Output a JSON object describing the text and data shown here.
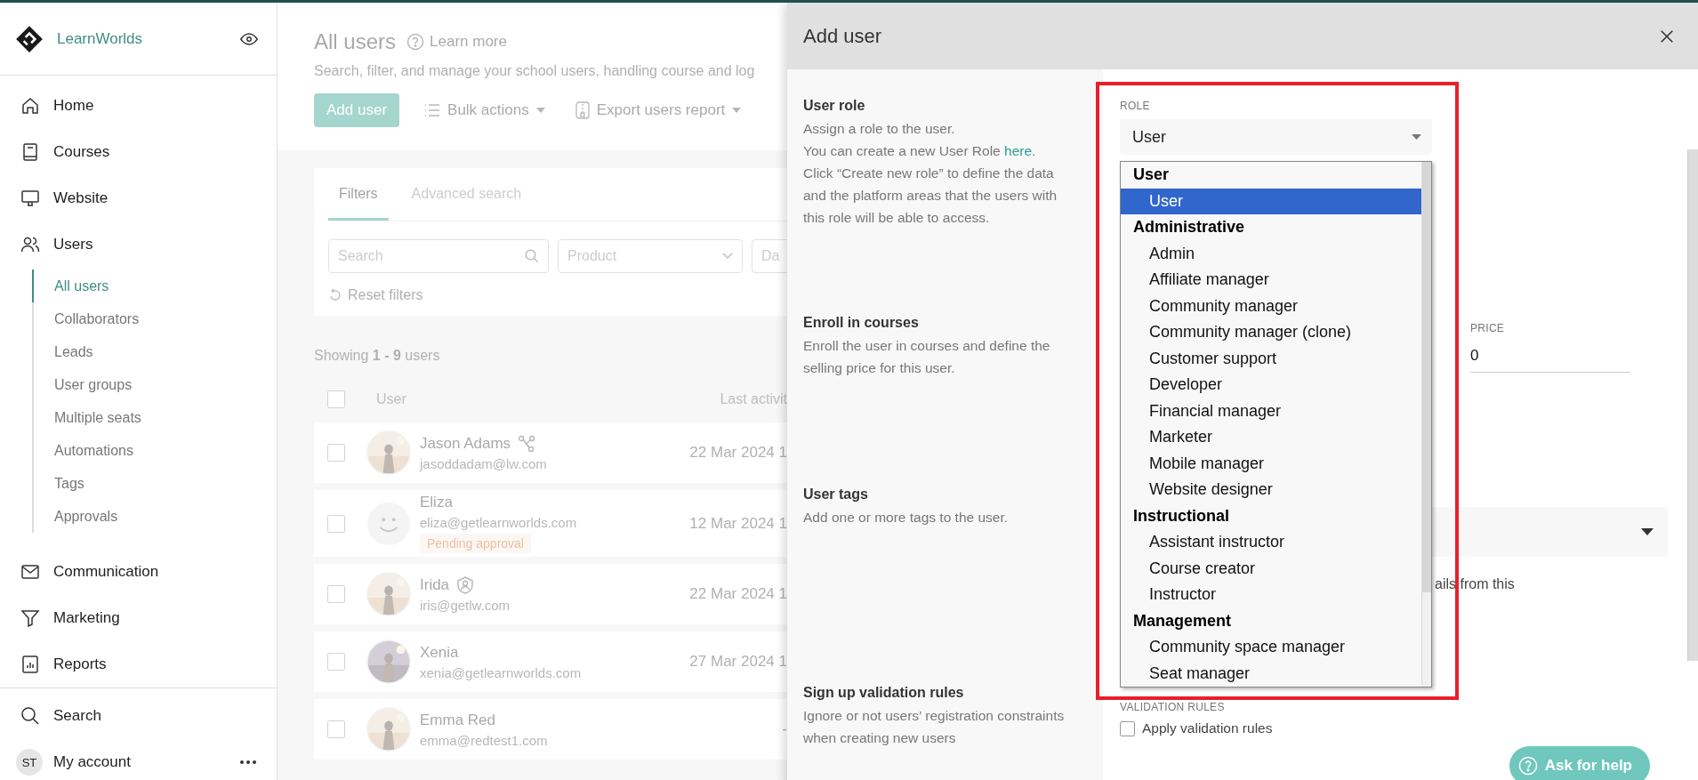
{
  "sidebar": {
    "brand": "LearnWorlds",
    "items": [
      {
        "label": "Home"
      },
      {
        "label": "Courses"
      },
      {
        "label": "Website"
      },
      {
        "label": "Users",
        "children": [
          {
            "label": "All users",
            "selected": true
          },
          {
            "label": "Collaborators",
            "selected": false
          },
          {
            "label": "Leads",
            "selected": false
          },
          {
            "label": "User groups",
            "selected": false
          },
          {
            "label": "Multiple seats",
            "selected": false
          },
          {
            "label": "Automations",
            "selected": false
          },
          {
            "label": "Tags",
            "selected": false
          },
          {
            "label": "Approvals",
            "selected": false
          }
        ]
      },
      {
        "label": "Communication"
      },
      {
        "label": "Marketing"
      },
      {
        "label": "Reports"
      }
    ],
    "search": "Search",
    "account": {
      "initials": "ST",
      "label": "My account"
    }
  },
  "main": {
    "title": "All users",
    "learn_more": "Learn more",
    "subtitle": "Search, filter, and manage your school users, handling course and log",
    "buttons": {
      "add": "Add user",
      "bulk": "Bulk actions",
      "export": "Export users report"
    },
    "filter_tabs": [
      {
        "label": "Filters",
        "selected": true
      },
      {
        "label": "Advanced search",
        "selected": false
      }
    ],
    "search_placeholder": "Search",
    "product_placeholder": "Product",
    "date_placeholder": "Da",
    "reset": "Reset filters",
    "showing": "Showing **1 - 9** users",
    "columns": [
      "User",
      "Last activit"
    ],
    "select_all_checked": false,
    "rows": [
      {
        "name": "Jason Adams",
        "email": "jasoddadam@lw.com",
        "date": "22 Mar 2024 1",
        "kind": "affiliate",
        "default_avatar": false,
        "checked": false
      },
      {
        "name": "Eliza",
        "email": "eliza@getlearnworlds.com",
        "date": "12 Mar 2024 1",
        "badge": "Pending approval",
        "kind": "plain",
        "default_avatar": true,
        "checked": false
      },
      {
        "name": "Irida",
        "email": "iris@getlw.com",
        "date": "22 Mar 2024 1",
        "kind": "staff",
        "default_avatar": false,
        "checked": false
      },
      {
        "name": "Xenia",
        "email": "xenia@getlearnworlds.com",
        "date": "27 Mar 2024 1",
        "kind": "plain",
        "default_avatar": false,
        "checked": false
      },
      {
        "name": "Emma Red",
        "email": "emma@redtest1.com",
        "date": "-",
        "kind": "plain",
        "default_avatar": false,
        "checked": false
      }
    ]
  },
  "modal": {
    "title": "Add user",
    "sections": [
      {
        "title": "User role",
        "intro": "Assign a role to the user.",
        "link_before": "You can create a new User Role ",
        "link": "here",
        "link_after": ".",
        "extra": "Click “Create new role” to define the data and the platform areas that the users with this role will be able to access."
      },
      {
        "title": "Enroll in courses",
        "intro": "Enroll the user in courses and define the selling price for this user."
      },
      {
        "title": "User tags",
        "intro": "Add one or more tags to the user."
      },
      {
        "title": "Sign up validation rules",
        "intro": "Ignore or not users’ registration constraints when creating new users"
      }
    ],
    "role": {
      "label": "ROLE",
      "value": "User",
      "groups": [
        {
          "label": "User",
          "options": [
            {
              "label": "User",
              "selected": true
            }
          ]
        },
        {
          "label": "Administrative",
          "options": [
            {
              "label": "Admin",
              "selected": false
            },
            {
              "label": "Affiliate manager",
              "selected": false
            },
            {
              "label": "Community manager",
              "selected": false
            },
            {
              "label": "Community manager (clone)",
              "selected": false
            },
            {
              "label": "Customer support",
              "selected": false
            },
            {
              "label": "Developer",
              "selected": false
            },
            {
              "label": "Financial manager",
              "selected": false
            },
            {
              "label": "Marketer",
              "selected": false
            },
            {
              "label": "Mobile manager",
              "selected": false
            },
            {
              "label": "Website designer",
              "selected": false
            }
          ]
        },
        {
          "label": "Instructional",
          "options": [
            {
              "label": "Assistant instructor",
              "selected": false
            },
            {
              "label": "Course creator",
              "selected": false
            },
            {
              "label": "Instructor",
              "selected": false
            }
          ]
        },
        {
          "label": "Management",
          "options": [
            {
              "label": "Community space manager",
              "selected": false
            },
            {
              "label": "Seat manager",
              "selected": false
            }
          ]
        }
      ]
    },
    "price": {
      "label": "PRICE",
      "value": "0"
    },
    "tags_note": "ails from this",
    "validation": {
      "label": "VALIDATION RULES",
      "checkbox": {
        "label": "Apply validation rules",
        "checked": false
      }
    }
  },
  "help": "Ask for help"
}
